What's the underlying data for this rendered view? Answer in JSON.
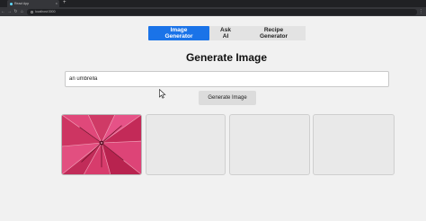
{
  "browser": {
    "tab_title": "React App",
    "url": "localhost:3000"
  },
  "nav": {
    "tabs": [
      {
        "label": "Image Generator",
        "active": true
      },
      {
        "label": "Ask AI",
        "active": false
      },
      {
        "label": "Recipe Generator",
        "active": false
      }
    ]
  },
  "main": {
    "title": "Generate Image",
    "prompt_value": "an umbrella",
    "generate_label": "Generate Image"
  },
  "gallery": {
    "slots": [
      {
        "filled": true,
        "image": "pink-umbrella-underside"
      },
      {
        "filled": false
      },
      {
        "filled": false
      },
      {
        "filled": false
      }
    ]
  },
  "colors": {
    "accent": "#1a73e8",
    "umbrella": "#d63a6a"
  }
}
